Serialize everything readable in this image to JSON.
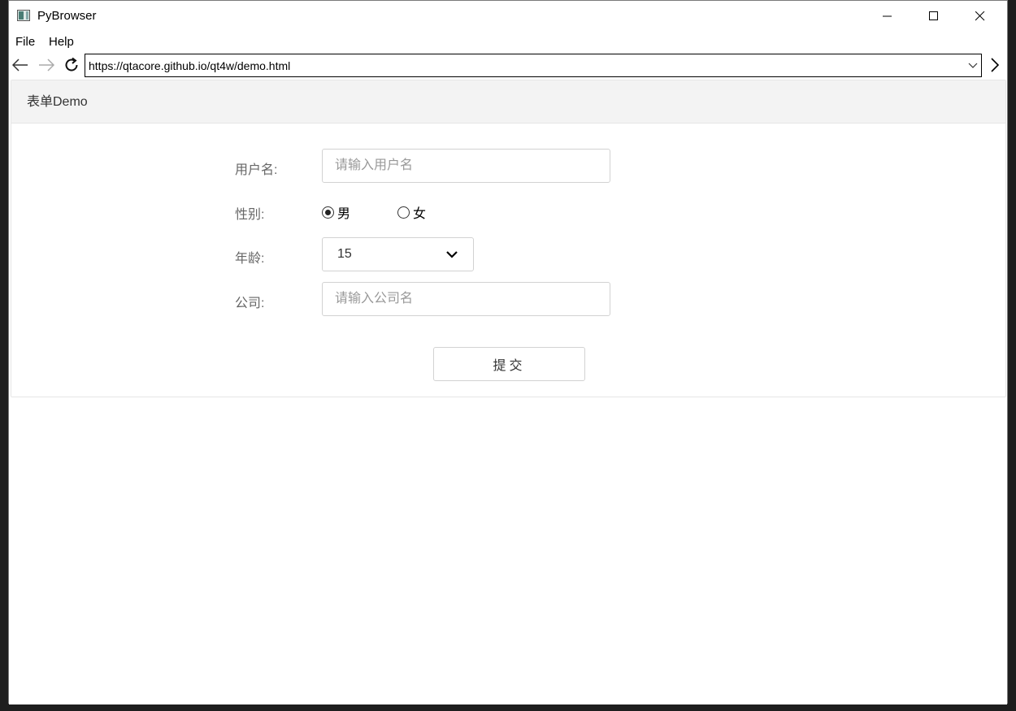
{
  "window": {
    "title": "PyBrowser",
    "icon": "app-window-icon"
  },
  "menu": {
    "items": [
      {
        "label": "File"
      },
      {
        "label": "Help"
      }
    ]
  },
  "navbar": {
    "url": "https://qtacore.github.io/qt4w/demo.html",
    "back_icon": "arrow-left-icon",
    "forward_icon": "arrow-right-icon",
    "reload_icon": "reload-icon",
    "go_icon": "chevron-right-icon"
  },
  "form": {
    "header": "表单Demo",
    "username": {
      "label": "用户名:",
      "placeholder": "请输入用户名",
      "value": ""
    },
    "gender": {
      "label": "性别:",
      "options": [
        "男",
        "女"
      ],
      "selected": "男"
    },
    "age": {
      "label": "年龄:",
      "selected": "15"
    },
    "company": {
      "label": "公司:",
      "placeholder": "请输入公司名",
      "value": ""
    },
    "submit_label": "提交"
  },
  "colors": {
    "header_bg": "#f3f3f3",
    "border": "#d2d2d2",
    "label_text": "#666666"
  }
}
